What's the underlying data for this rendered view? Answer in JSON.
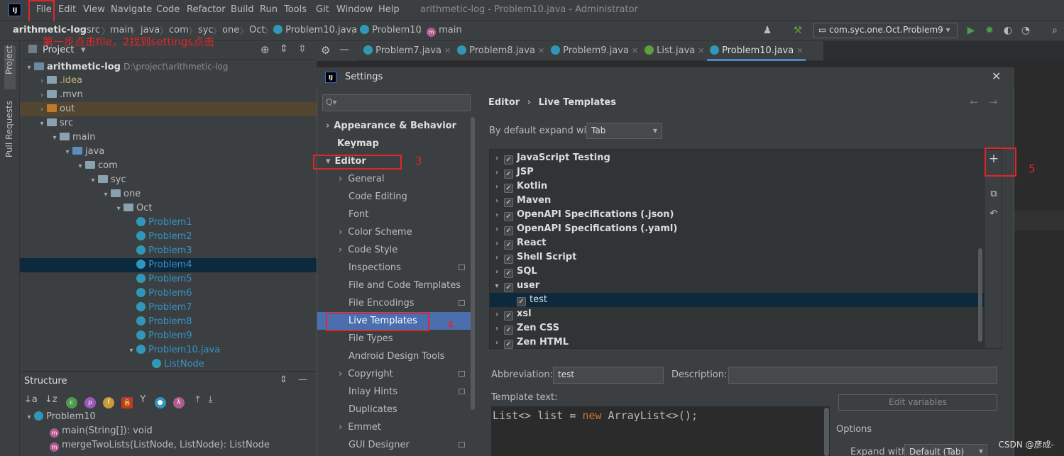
{
  "menubar": {
    "items": [
      "File",
      "Edit",
      "View",
      "Navigate",
      "Code",
      "Refactor",
      "Build",
      "Run",
      "Tools",
      "Git",
      "Window",
      "Help"
    ],
    "window_title": "arithmetic-log - Problem10.java - Administrator",
    "logo": "IJ"
  },
  "navbar": {
    "breadcrumbs": [
      "arithmetic-log",
      "src",
      "main",
      "java",
      "com",
      "syc",
      "one",
      "Oct",
      "Problem10.java",
      "Problem10",
      "main"
    ],
    "run_config": "com.syc.one.Oct.Problem9"
  },
  "annotations": {
    "step1": "第一步点击file，2找到settings点击",
    "step3": "3",
    "step4": "4",
    "step5": "5"
  },
  "stripe": {
    "project": "Project",
    "pull_requests": "Pull Requests"
  },
  "project_panel": {
    "title": "Project",
    "rows": [
      {
        "label": "arithmetic-log",
        "path": "D:\\project\\arithmetic-log"
      },
      {
        "label": ".idea"
      },
      {
        "label": ".mvn"
      },
      {
        "label": "out"
      },
      {
        "label": "src"
      },
      {
        "label": "main"
      },
      {
        "label": "java"
      },
      {
        "label": "com"
      },
      {
        "label": "syc"
      },
      {
        "label": "one"
      },
      {
        "label": "Oct"
      },
      {
        "label": "Problem1"
      },
      {
        "label": "Problem2"
      },
      {
        "label": "Problem3"
      },
      {
        "label": "Problem4"
      },
      {
        "label": "Problem5"
      },
      {
        "label": "Problem6"
      },
      {
        "label": "Problem7"
      },
      {
        "label": "Problem8"
      },
      {
        "label": "Problem9"
      },
      {
        "label": "Problem10.java"
      },
      {
        "label": "ListNode"
      }
    ]
  },
  "structure_panel": {
    "title": "Structure",
    "rows": [
      "Problem10",
      "main(String[]): void",
      "mergeTwoLists(ListNode, ListNode): ListNode"
    ]
  },
  "editor_tabs": [
    "Problem7.java",
    "Problem8.java",
    "Problem9.java",
    "List.java",
    "Problem10.java"
  ],
  "settings": {
    "title": "Settings",
    "logo": "IJ",
    "search_placeholder": "Q▾",
    "nav": [
      {
        "label": "Appearance & Behavior"
      },
      {
        "label": "Keymap"
      },
      {
        "label": "Editor"
      },
      {
        "label": "General"
      },
      {
        "label": "Code Editing"
      },
      {
        "label": "Font"
      },
      {
        "label": "Color Scheme"
      },
      {
        "label": "Code Style"
      },
      {
        "label": "Inspections"
      },
      {
        "label": "File and Code Templates"
      },
      {
        "label": "File Encodings"
      },
      {
        "label": "Live Templates"
      },
      {
        "label": "File Types"
      },
      {
        "label": "Android Design Tools"
      },
      {
        "label": "Copyright"
      },
      {
        "label": "Inlay Hints"
      },
      {
        "label": "Duplicates"
      },
      {
        "label": "Emmet"
      },
      {
        "label": "GUI Designer"
      }
    ],
    "breadcrumb": {
      "parent": "Editor",
      "current": "Live Templates"
    },
    "expand_label": "By default expand with",
    "expand_value": "Tab",
    "templates": [
      {
        "label": "JavaScript Testing"
      },
      {
        "label": "JSP"
      },
      {
        "label": "Kotlin"
      },
      {
        "label": "Maven"
      },
      {
        "label": "OpenAPI Specifications (.json)"
      },
      {
        "label": "OpenAPI Specifications (.yaml)"
      },
      {
        "label": "React"
      },
      {
        "label": "Shell Script"
      },
      {
        "label": "SQL"
      },
      {
        "label": "user"
      },
      {
        "label": "test"
      },
      {
        "label": "xsl"
      },
      {
        "label": "Zen CSS"
      },
      {
        "label": "Zen HTML"
      }
    ],
    "abbreviation_label": "Abbreviation:",
    "abbreviation_value": "test",
    "description_label": "Description:",
    "description_value": "",
    "template_text_label": "Template text:",
    "template_code": {
      "p1": "List<> list = ",
      "kw": "new",
      "p2": " ArrayList<>();"
    },
    "edit_variables": "Edit variables",
    "options_label": "Options",
    "expand_with_label": "Expand with",
    "expand_with_value": "Default (Tab)"
  },
  "watermark": "CSDN @彦成-"
}
